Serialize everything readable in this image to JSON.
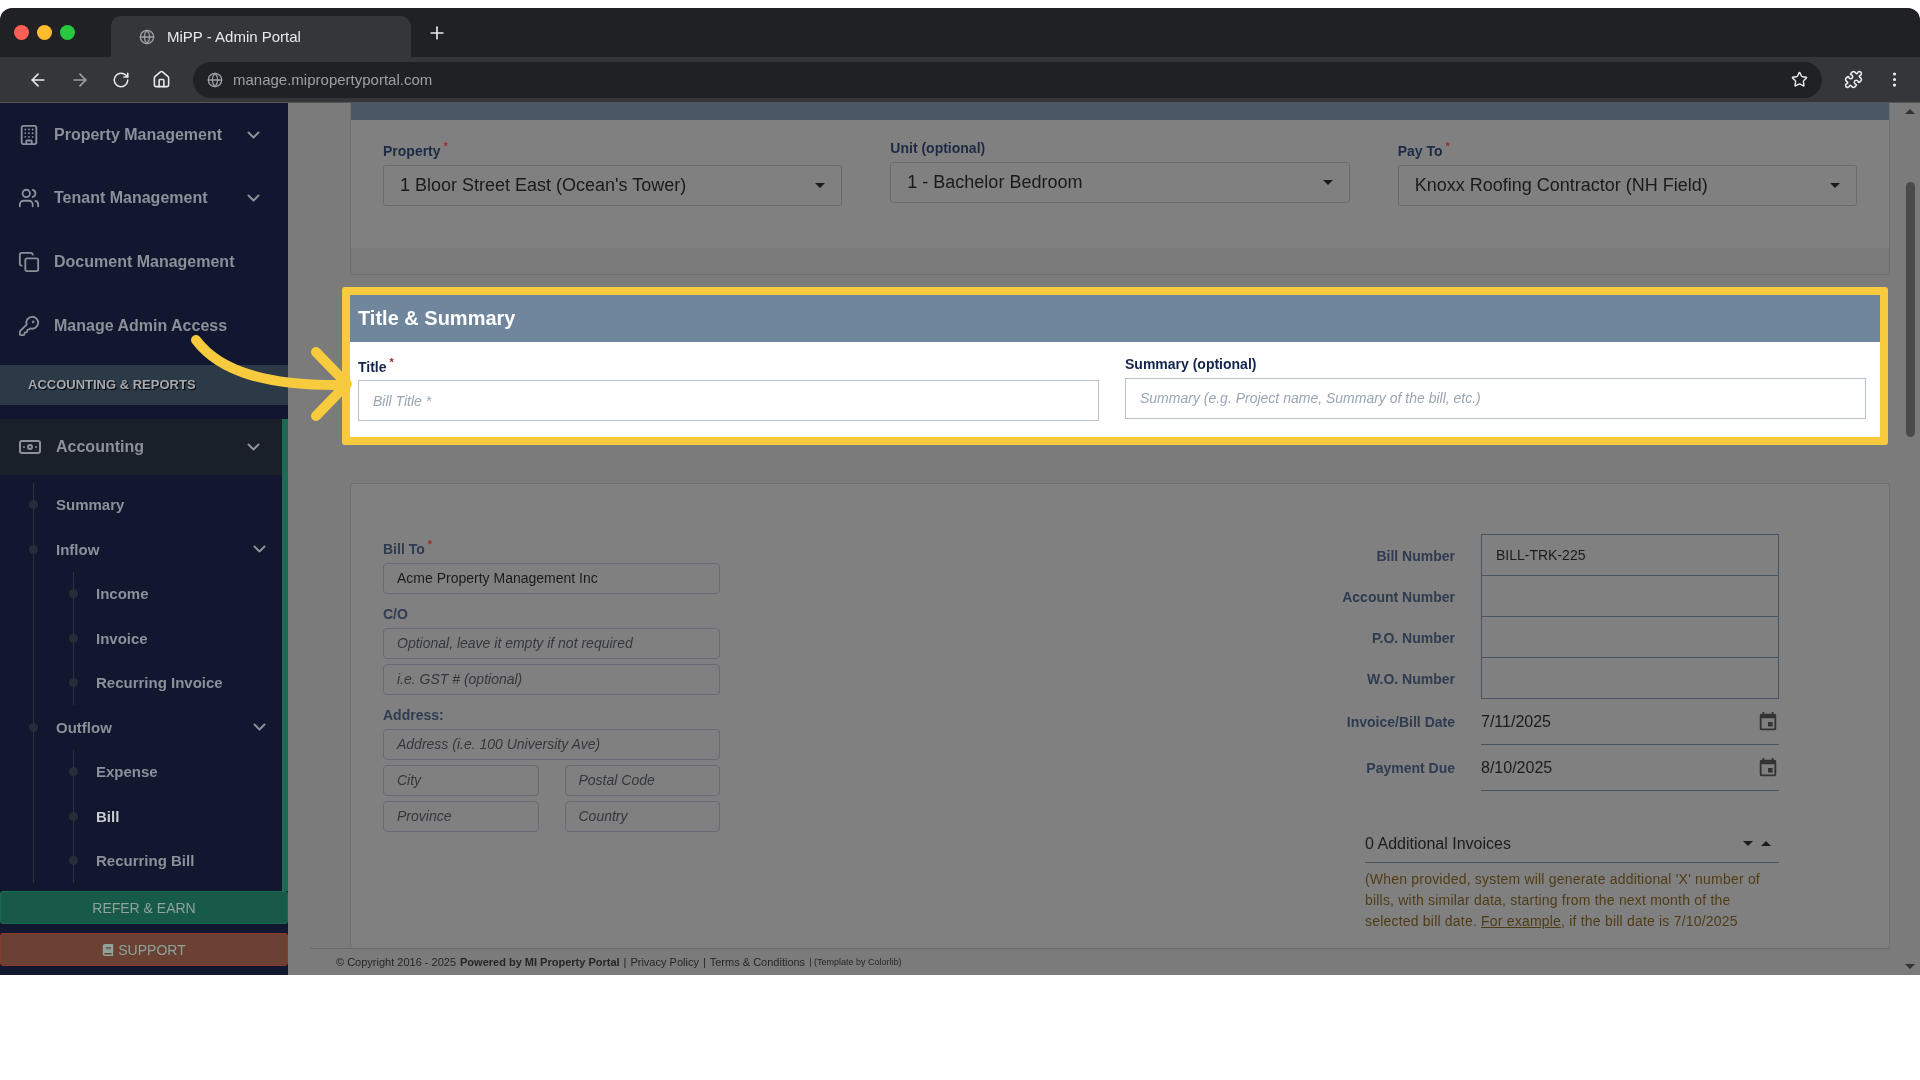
{
  "browser": {
    "tab_title": "MiPP - Admin Portal",
    "url": "manage.mipropertyportal.com"
  },
  "sidebar": {
    "items": [
      {
        "label": "Property Management",
        "collapsible": true
      },
      {
        "label": "Tenant Management",
        "collapsible": true
      },
      {
        "label": "Document Management",
        "collapsible": false
      },
      {
        "label": "Manage Admin Access",
        "collapsible": false
      }
    ],
    "section_title": "ACCOUNTING & REPORTS",
    "accounting": {
      "label": "Accounting",
      "expanded": true,
      "children": [
        {
          "label": "Summary",
          "selected": false
        },
        {
          "label": "Inflow",
          "expanded": true,
          "selected": false,
          "children": [
            {
              "label": "Income",
              "selected": false
            },
            {
              "label": "Invoice",
              "selected": false
            },
            {
              "label": "Recurring Invoice",
              "selected": false
            }
          ]
        },
        {
          "label": "Outflow",
          "expanded": true,
          "selected": false,
          "children": [
            {
              "label": "Expense",
              "selected": false
            },
            {
              "label": "Bill",
              "selected": true
            },
            {
              "label": "Recurring Bill",
              "selected": false
            }
          ]
        }
      ]
    },
    "buttons": [
      {
        "kind": "refer",
        "label": "REFER & EARN"
      },
      {
        "kind": "support",
        "label": "SUPPORT"
      }
    ]
  },
  "property_section": {
    "fields": [
      {
        "label": "Property",
        "mark": "*",
        "value": "1 Bloor Street East (Ocean's Tower)"
      },
      {
        "label": "Unit (optional)",
        "value": "1 - Bachelor Bedroom"
      },
      {
        "label": "Pay To",
        "mark": "*",
        "value": "Knoxx Roofing Contractor (NH Field)"
      }
    ]
  },
  "title_summary": {
    "title": "Title & Summary",
    "fields": [
      {
        "label": "Title",
        "mark": "*",
        "placeholder": "Bill Title *"
      },
      {
        "label": "Summary (optional)",
        "placeholder": "Summary (e.g. Project name, Summary of the bill, etc.)"
      }
    ]
  },
  "bill_section": {
    "left": [
      {
        "kind": "label",
        "text": "Bill To",
        "mark": "*"
      },
      {
        "kind": "input",
        "value": "Acme Property Management Inc"
      },
      {
        "kind": "label",
        "text": "C/O"
      },
      {
        "kind": "input",
        "placeholder": "Optional, leave it empty if not required"
      },
      {
        "kind": "input",
        "placeholder": "i.e. GST # (optional)"
      },
      {
        "kind": "label",
        "text": "Address:"
      },
      {
        "kind": "input",
        "placeholder": "Address (i.e. 100 University Ave)"
      },
      {
        "kind": "pair",
        "items": [
          {
            "placeholder": "City"
          },
          {
            "placeholder": "Postal Code"
          }
        ]
      },
      {
        "kind": "pair",
        "items": [
          {
            "placeholder": "Province"
          },
          {
            "placeholder": "Country"
          }
        ]
      }
    ],
    "right": [
      {
        "kind": "box",
        "label": "Bill Number",
        "value": "BILL-TRK-225"
      },
      {
        "kind": "box",
        "label": "Account Number"
      },
      {
        "kind": "box",
        "label": "P.O. Number"
      },
      {
        "kind": "box",
        "label": "W.O. Number"
      },
      {
        "kind": "date",
        "label": "Invoice/Bill Date",
        "value": "7/11/2025"
      },
      {
        "kind": "date",
        "label": "Payment Due",
        "value": "8/10/2025"
      }
    ],
    "additional": {
      "label": "0 Additional Invoices",
      "note_before": "(When provided, system will generate additional 'X' number of bills, with similar data, starting from the next month of the selected bill date. ",
      "link": "For example",
      "note_after": ", if the bill date is 7/10/2025"
    }
  },
  "footer": [
    {
      "kind": "text",
      "text": "© Copyright 2016 - 2025"
    },
    {
      "kind": "bold",
      "text": "Powered by MI Property Portal"
    },
    {
      "kind": "sep",
      "text": "|"
    },
    {
      "kind": "link",
      "text": "Privacy Policy"
    },
    {
      "kind": "sep",
      "text": "|"
    },
    {
      "kind": "link",
      "text": "Terms & Conditions"
    },
    {
      "kind": "small",
      "text": "| (Template by Colorlib)"
    }
  ]
}
